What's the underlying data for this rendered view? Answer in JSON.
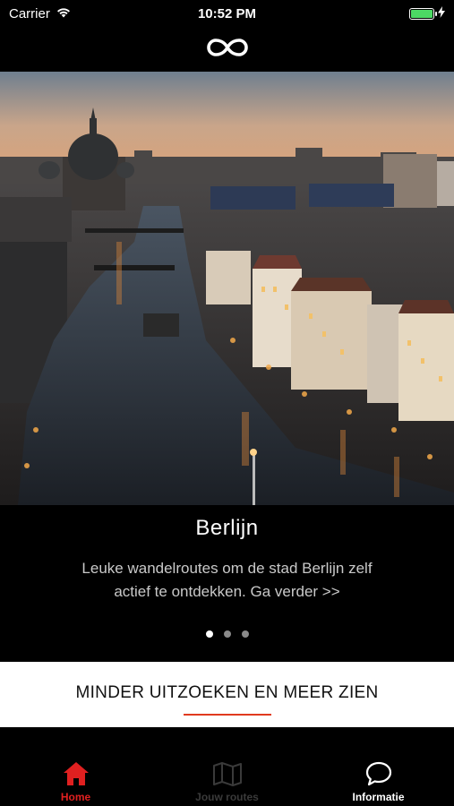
{
  "status_bar": {
    "carrier": "Carrier",
    "time": "10:52 PM",
    "battery_color": "#4cd964"
  },
  "header": {
    "logo_icon": "infinity-logo-icon"
  },
  "hero": {
    "city": "Berlijn",
    "description": "Leuke wandelroutes om de stad Berlijn zelf actief te ontdekken. Ga verder >>",
    "page_count": 3,
    "active_page": 1
  },
  "banner": {
    "tagline": "MINDER UITZOEKEN EN MEER ZIEN",
    "accent_color": "#e03a1e"
  },
  "tabbar": {
    "items": [
      {
        "label": "Home",
        "icon": "home-icon",
        "state": "active",
        "color": "#e02020"
      },
      {
        "label": "Jouw routes",
        "icon": "map-icon",
        "state": "disabled",
        "color": "#3a3a3a"
      },
      {
        "label": "Informatie",
        "icon": "chat-bubble-icon",
        "state": "normal",
        "color": "#ffffff"
      }
    ]
  }
}
